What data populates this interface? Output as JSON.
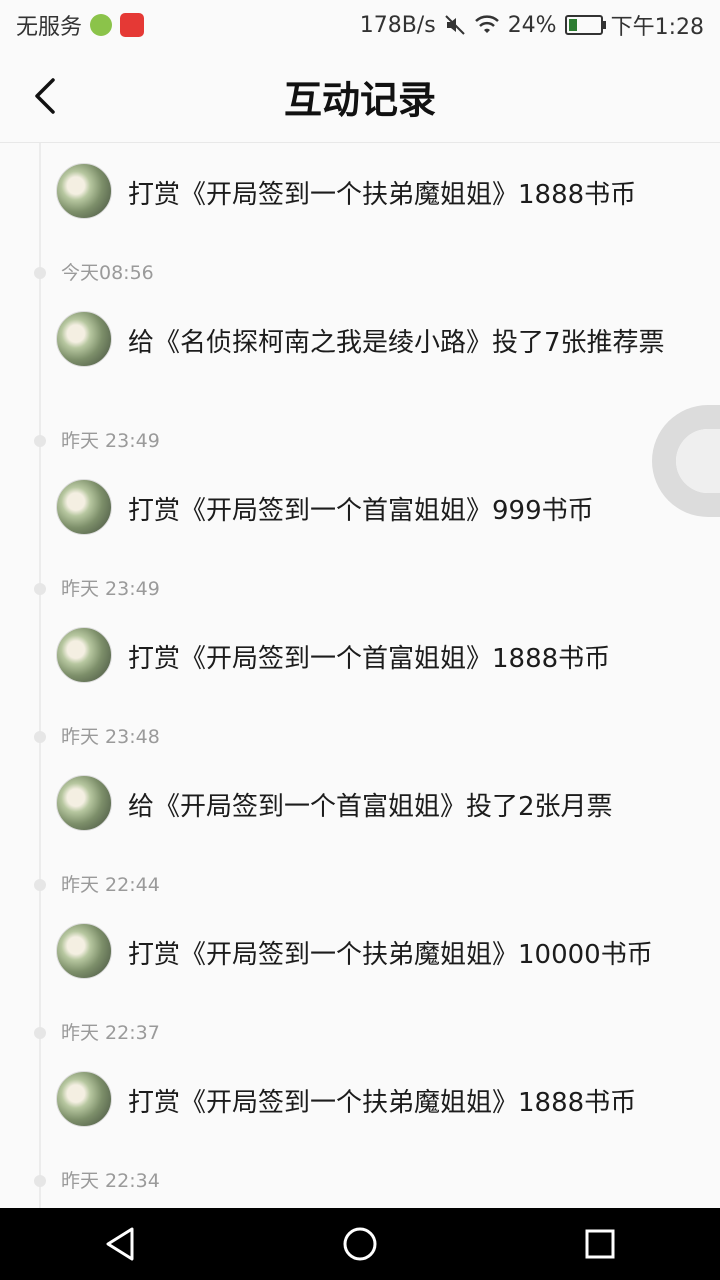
{
  "status_bar": {
    "carrier": "无服务",
    "net_speed": "178B/s",
    "battery": "24%",
    "time": "下午1:28"
  },
  "header": {
    "title": "互动记录"
  },
  "icons": {
    "back": "chevron-left-icon",
    "mute": "mute-icon",
    "wifi": "wifi-icon",
    "nav_back": "triangle-back-icon",
    "nav_home": "circle-home-icon",
    "nav_recent": "square-recent-icon"
  },
  "records": [
    {
      "time": "",
      "text": "打赏《开局签到一个扶弟魔姐姐》1888书币"
    },
    {
      "time": "今天08:56",
      "text": "给《名侦探柯南之我是绫小路》投了7张推荐票"
    },
    {
      "time": "昨天 23:49",
      "text": "打赏《开局签到一个首富姐姐》999书币"
    },
    {
      "time": "昨天 23:49",
      "text": "打赏《开局签到一个首富姐姐》1888书币"
    },
    {
      "time": "昨天 23:48",
      "text": "给《开局签到一个首富姐姐》投了2张月票"
    },
    {
      "time": "昨天 22:44",
      "text": "打赏《开局签到一个扶弟魔姐姐》10000书币"
    },
    {
      "time": "昨天 22:37",
      "text": "打赏《开局签到一个扶弟魔姐姐》1888书币"
    },
    {
      "time": "昨天 22:34",
      "text": ""
    }
  ]
}
